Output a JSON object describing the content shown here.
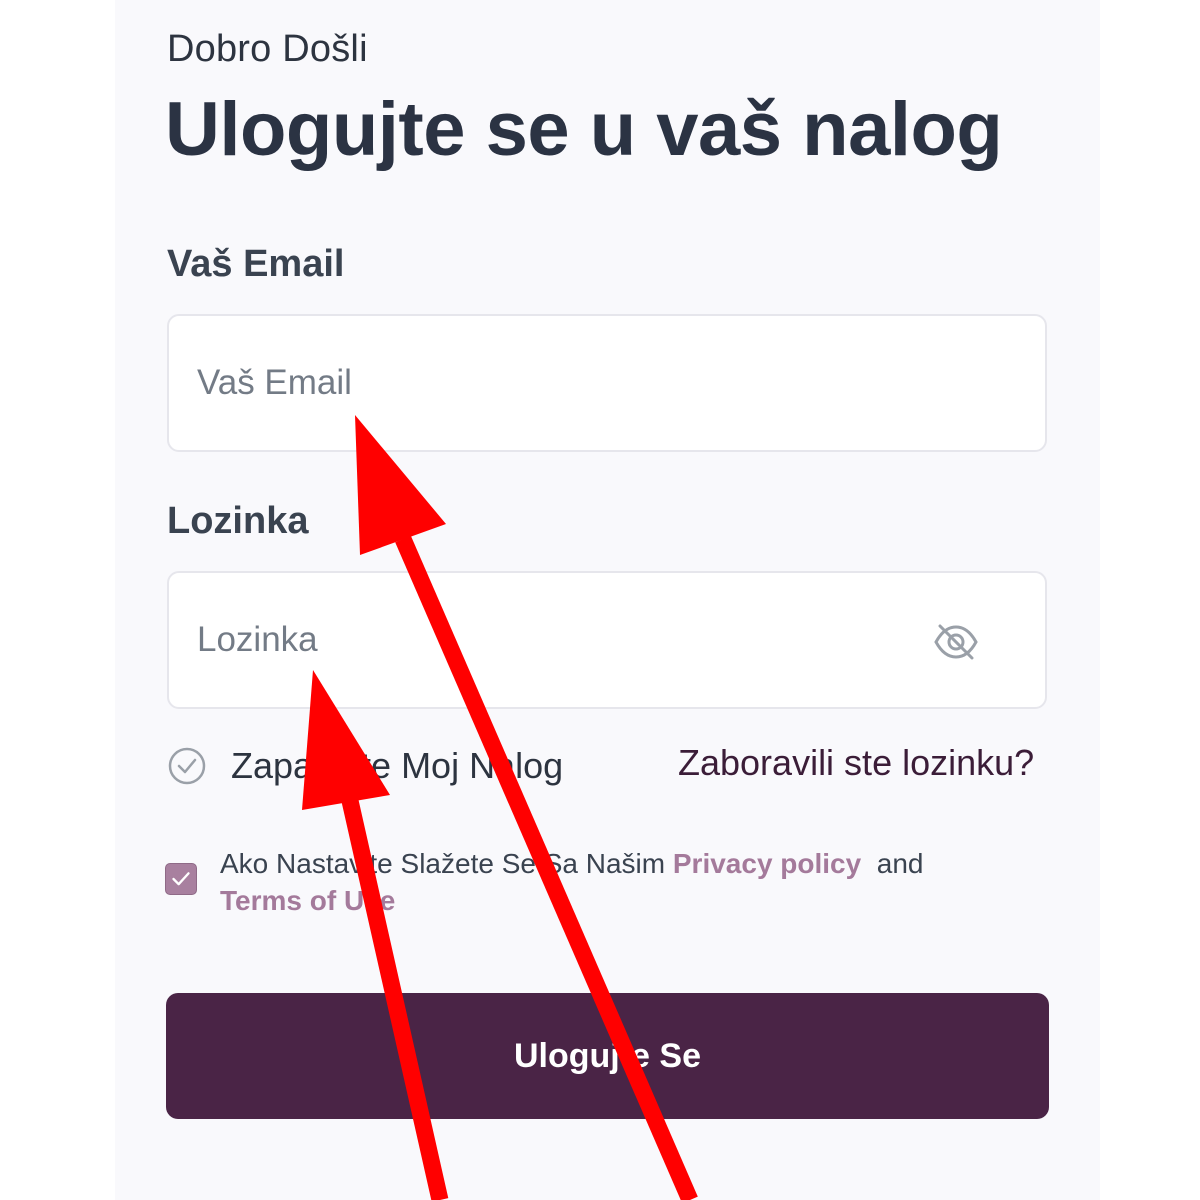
{
  "header": {
    "greeting": "Dobro Došli",
    "title": "Ulogujte se u vaš nalog"
  },
  "email": {
    "label": "Vaš Email",
    "placeholder": "Vaš Email",
    "value": ""
  },
  "password": {
    "label": "Lozinka",
    "placeholder": "Lozinka",
    "value": "",
    "toggle_icon": "eye-off-icon"
  },
  "remember": {
    "label": "Zapamtite Moj Nalog",
    "checked": false,
    "icon": "circle-check-icon"
  },
  "forgot_password": {
    "label": "Zaboravili ste lozinku?"
  },
  "terms": {
    "checked": true,
    "text_before": "Ako Nastavite Slažete Se Sa Našim",
    "privacy_link": "Privacy policy",
    "conjunction": "and",
    "terms_link": "Terms of Use"
  },
  "submit": {
    "label": "Ulogujte Se"
  },
  "colors": {
    "primary": "#4a2446",
    "link_accent": "#a47a9b",
    "annotation_arrow": "#ff0000"
  }
}
